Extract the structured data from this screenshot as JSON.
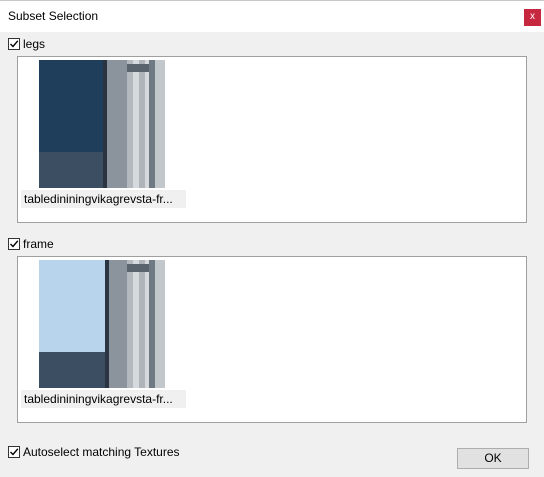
{
  "window": {
    "title": "Subset Selection",
    "close_label": "x"
  },
  "subsets": [
    {
      "name": "legs",
      "checked": true,
      "texture_caption": "tabledininingvikagrevsta-fr..."
    },
    {
      "name": "frame",
      "checked": true,
      "texture_caption": "tabledininingvikagrevsta-fr..."
    }
  ],
  "autoselect": {
    "label": "Autoselect matching Textures",
    "checked": true
  },
  "ok_label": "OK",
  "colors": {
    "close_bg": "#c6283f",
    "panel_bg": "#ffffff",
    "dialog_bg": "#f0f0f0"
  }
}
